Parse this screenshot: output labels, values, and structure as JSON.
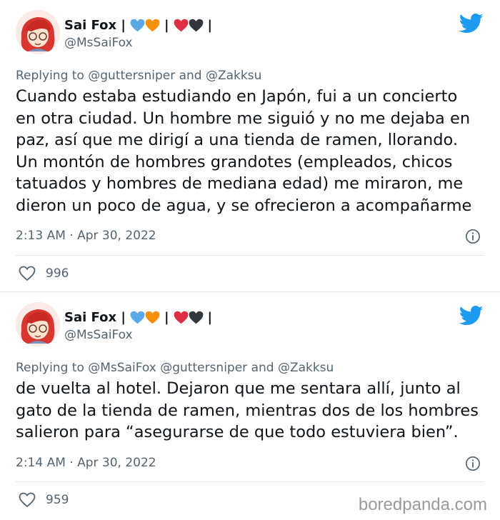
{
  "tweets": [
    {
      "display_name": "Sai Fox |",
      "emoji_separators": [
        "|",
        "|"
      ],
      "handle": "@MsSaiFox",
      "replying_prefix": "Replying to",
      "replying_mentions": "@guttersniper and @Zakksu",
      "text_lines": [
        "Cuando estaba estudiando en Japón, fui a un concierto",
        "en otra ciudad. Un hombre me siguió y no me dejaba en",
        "paz, así que me dirigí a una tienda de ramen, llorando.",
        "Un montón de hombres grandotes (empleados, chicos",
        "tatuados y hombres de mediana edad) me miraron, me",
        "dieron un poco de agua, y se ofrecieron a acompañarme"
      ],
      "timestamp": "2:13 AM · Apr 30, 2022",
      "likes": "996"
    },
    {
      "display_name": "Sai Fox |",
      "emoji_separators": [
        "|",
        "|"
      ],
      "handle": "@MsSaiFox",
      "replying_prefix": "Replying to",
      "replying_mentions": "@MsSaiFox @guttersniper and @Zakksu",
      "text_lines": [
        "de vuelta al hotel. Dejaron que me sentara allí, junto al",
        "gato de la tienda de ramen, mientras dos de los hombres",
        "salieron para “asegurarse de que todo estuviera bien”."
      ],
      "timestamp": "2:14 AM · Apr 30, 2022",
      "likes": "959"
    }
  ],
  "watermark": "boredpanda.com",
  "colors": {
    "twitter_blue": "#1d9bf0",
    "secondary_text": "#536471",
    "heart_blue": "#5aa9e6",
    "heart_orange": "#f4900c",
    "heart_red": "#dd2e44",
    "heart_black": "#31373d"
  },
  "icons": [
    "twitter-bird-icon",
    "info-icon",
    "like-heart-icon",
    "blue-heart-icon",
    "orange-heart-icon",
    "red-heart-icon",
    "black-heart-icon"
  ]
}
